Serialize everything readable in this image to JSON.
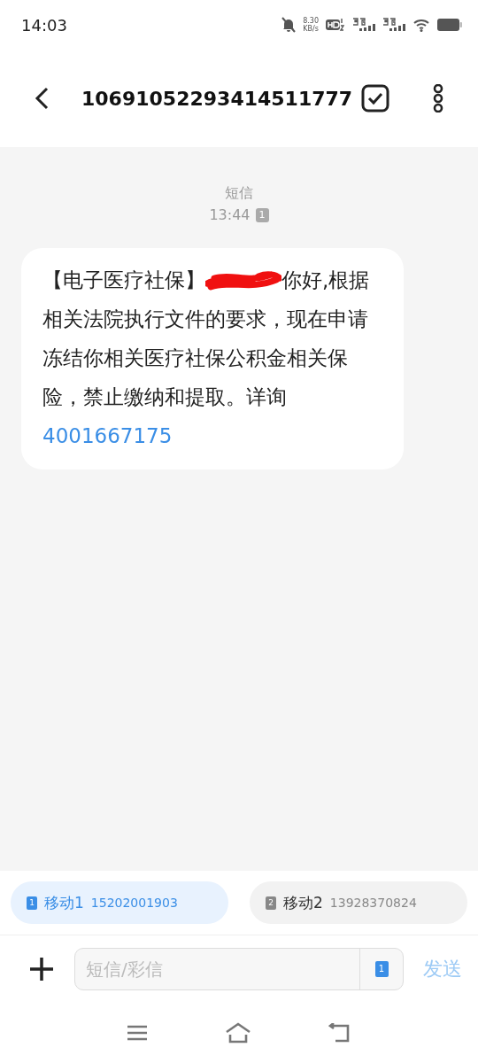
{
  "status_bar": {
    "time": "14:03",
    "speed": "8.30",
    "speed_unit": "KB/s"
  },
  "header": {
    "title": "10691052293414511777"
  },
  "conversation": {
    "channel": "短信",
    "time": "13:44",
    "sim": "1"
  },
  "message": {
    "prefix": "【电子医疗社保】",
    "text": "你好,根据相关法院执行文件的要求，现在申请冻结你相关医疗社保公积金相关保险，禁止缴纳和提取。详询",
    "phone": "4001667175"
  },
  "sims": [
    {
      "slot": "1",
      "name": "移动1",
      "number": "15202001903",
      "selected": true
    },
    {
      "slot": "2",
      "name": "移动2",
      "number": "13928370824",
      "selected": false
    }
  ],
  "composer": {
    "placeholder": "短信/彩信",
    "sim": "1",
    "send": "发送"
  }
}
